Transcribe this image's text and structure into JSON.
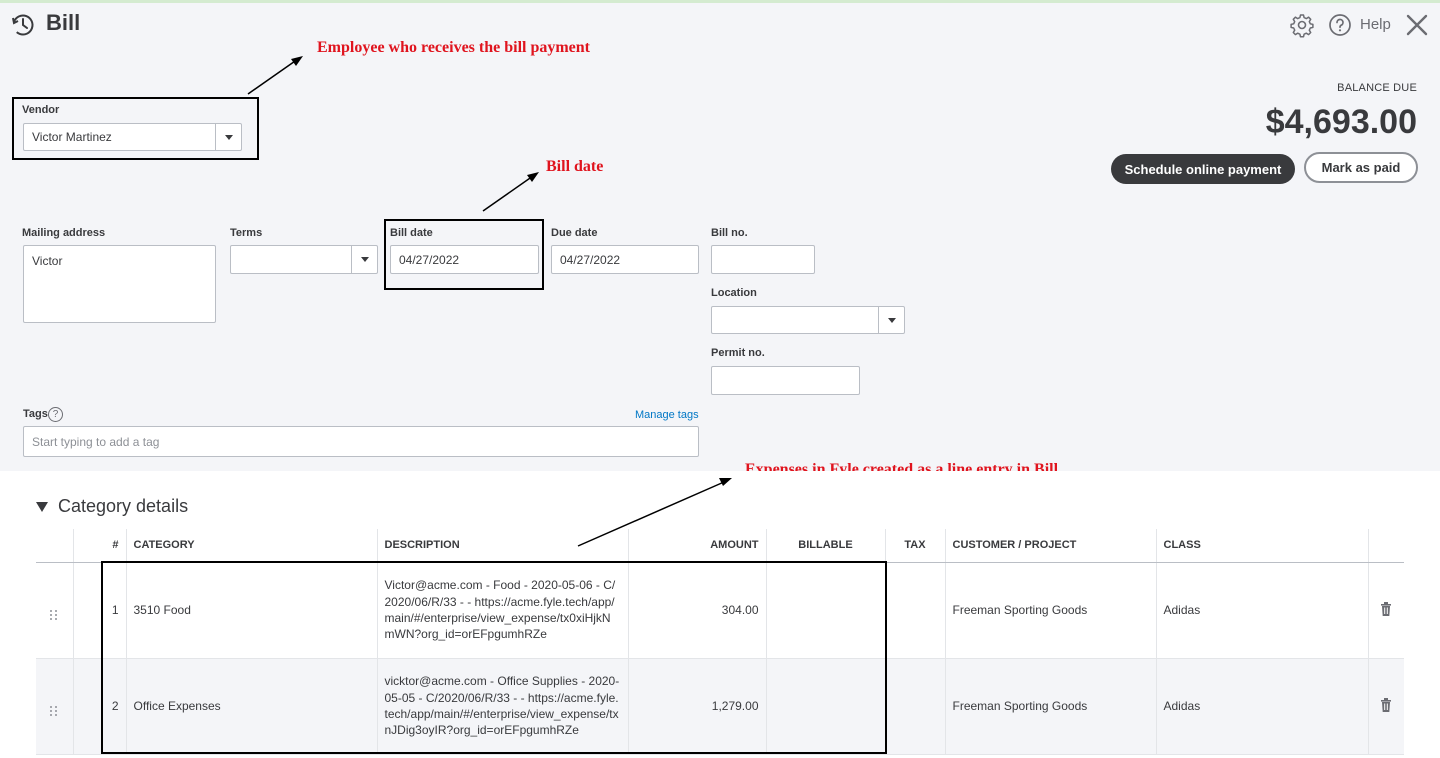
{
  "header": {
    "title": "Bill",
    "help_label": "Help"
  },
  "annotations": {
    "vendor_note": "Employee who receives the bill payment",
    "date_note": "Bill date",
    "lines_note": "Expenses in Fyle created as a line entry in Bill"
  },
  "vendor": {
    "label": "Vendor",
    "value": "Victor Martinez"
  },
  "balance": {
    "label": "BALANCE DUE",
    "amount": "$4,693.00"
  },
  "buttons": {
    "schedule": "Schedule online payment",
    "mark_paid": "Mark as paid"
  },
  "form": {
    "mailing_label": "Mailing address",
    "mailing_value": "Victor",
    "terms_label": "Terms",
    "terms_value": "",
    "bill_date_label": "Bill date",
    "bill_date_value": "04/27/2022",
    "due_date_label": "Due date",
    "due_date_value": "04/27/2022",
    "bill_no_label": "Bill no.",
    "bill_no_value": "",
    "location_label": "Location",
    "location_value": "",
    "permit_label": "Permit no.",
    "permit_value": "",
    "tags_label": "Tags",
    "tags_placeholder": "Start typing to add a tag",
    "manage_tags": "Manage tags"
  },
  "category": {
    "title": "Category details",
    "columns": [
      "#",
      "CATEGORY",
      "DESCRIPTION",
      "AMOUNT",
      "BILLABLE",
      "TAX",
      "CUSTOMER / PROJECT",
      "CLASS"
    ],
    "rows": [
      {
        "num": "1",
        "category": "3510 Food",
        "description": "Victor@acme.com - Food - 2020-05-06 - C/2020/06/R/33 -  - https://acme.fyle.tech/app/main/#/enterprise/view_expense/tx0xiHjkNmWN?org_id=orEFpgumhRZe",
        "amount": "304.00",
        "billable": "",
        "tax": "",
        "customer": "Freeman Sporting Goods",
        "class": "Adidas"
      },
      {
        "num": "2",
        "category": "Office Expenses",
        "description": "vicktor@acme.com - Office Supplies - 2020-05-05 - C/2020/06/R/33 -  - https://acme.fyle.tech/app/main/#/enterprise/view_expense/txnJDig3oyIR?org_id=orEFpgumhRZe",
        "amount": "1,279.00",
        "billable": "",
        "tax": "",
        "customer": "Freeman Sporting Goods",
        "class": "Adidas"
      }
    ]
  }
}
